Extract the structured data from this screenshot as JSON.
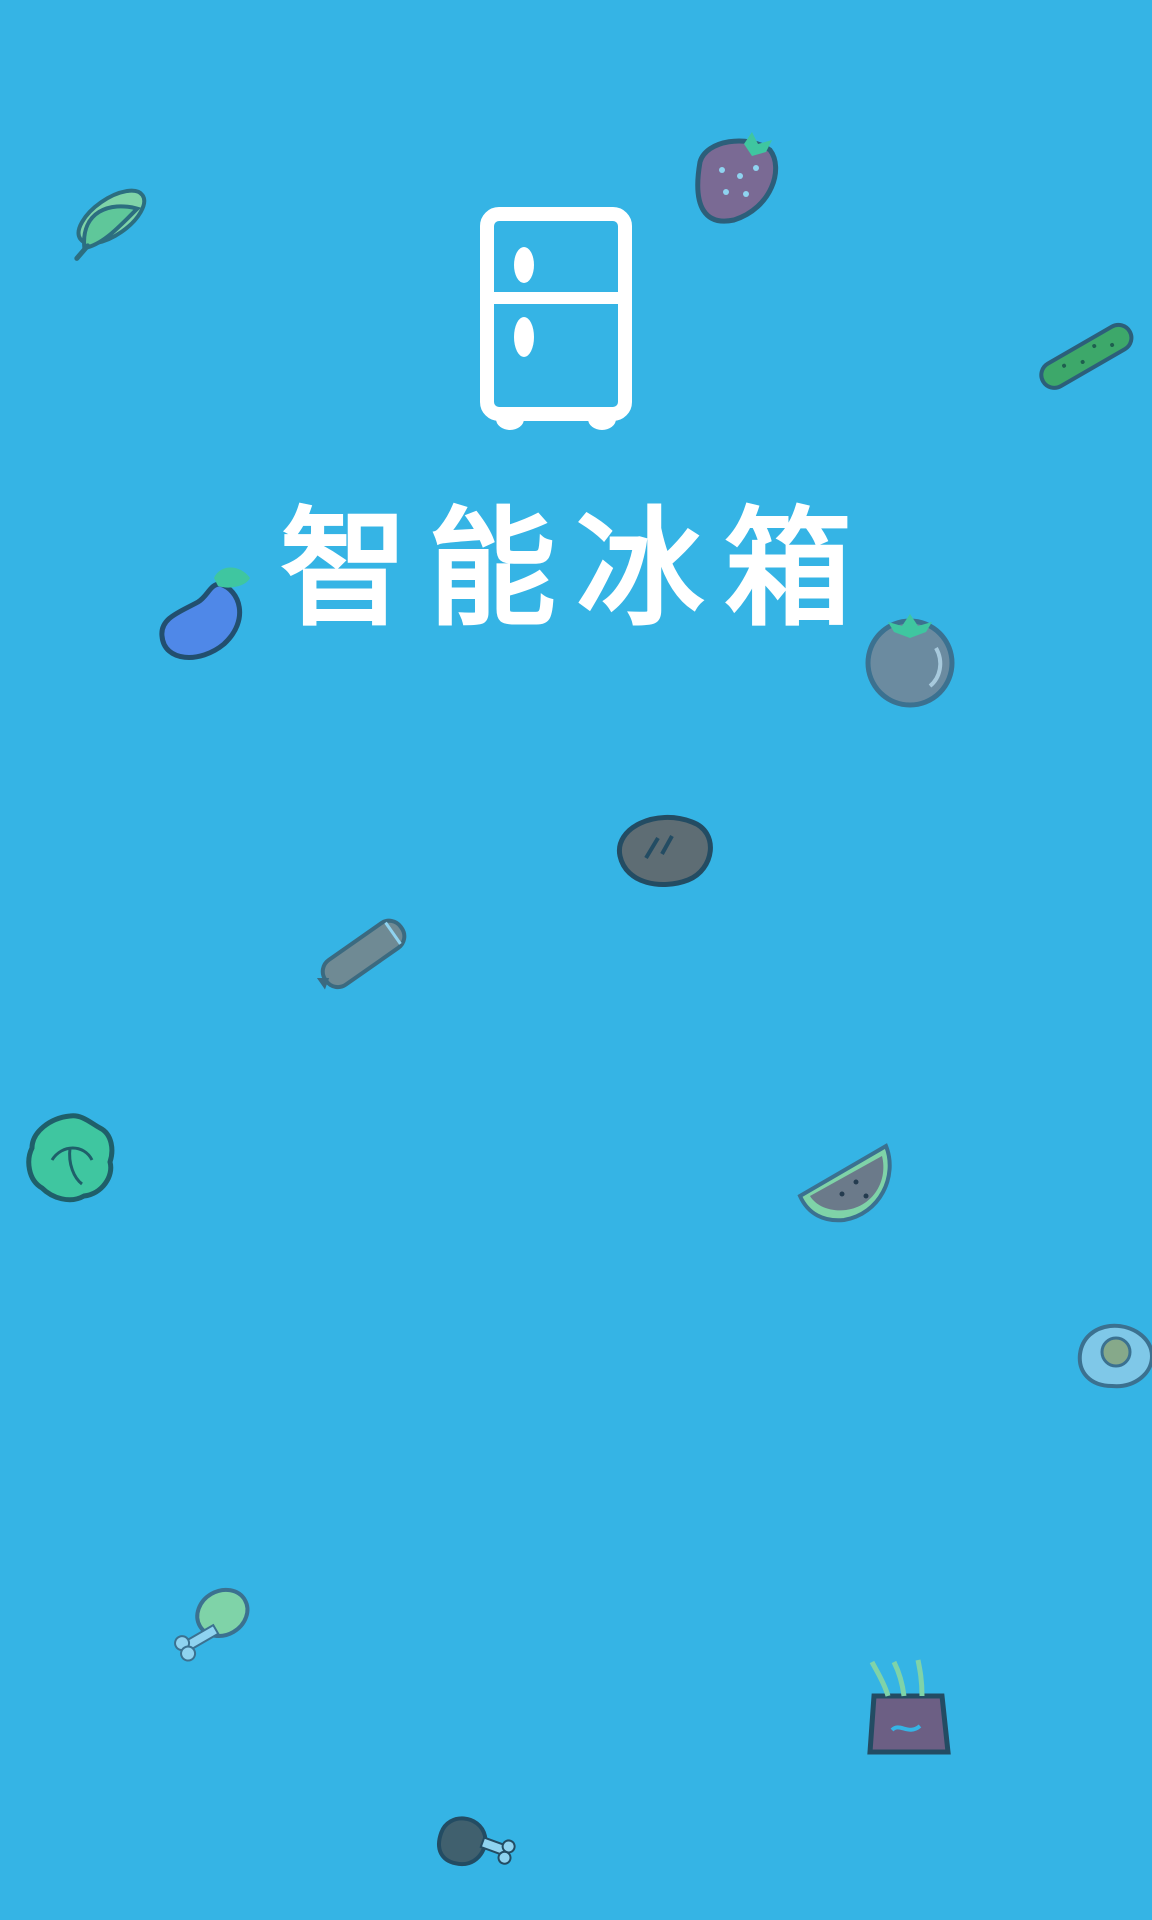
{
  "app": {
    "title": "智能冰箱"
  },
  "logo": {
    "icon": "fridge-icon",
    "color": "#ffffff"
  },
  "background": {
    "color": "#35b4e5"
  },
  "decorations": [
    "corn-icon",
    "strawberry-icon",
    "cucumber-icon",
    "eggplant-icon",
    "tomato-icon",
    "steak-icon",
    "sausage-icon",
    "cabbage-icon",
    "watermelon-icon",
    "fried-egg-icon",
    "chicken-leg-icon",
    "noodles-icon",
    "ham-icon"
  ]
}
